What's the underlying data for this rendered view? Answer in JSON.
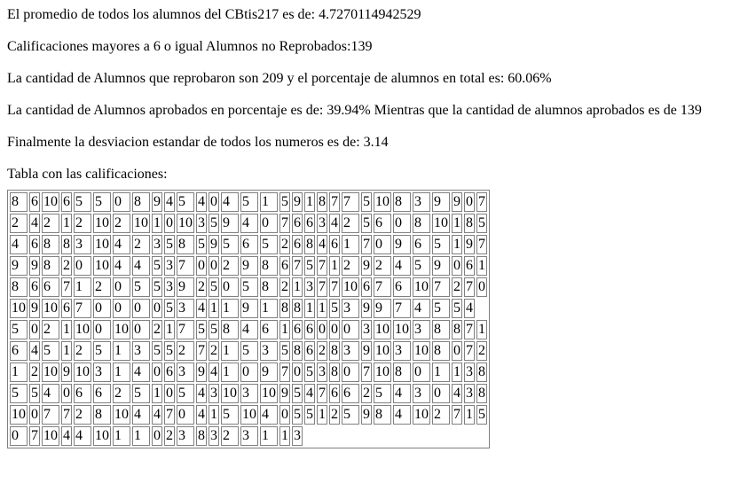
{
  "lines": {
    "promedio": "El promedio de todos los alumnos del CBtis217 es de: 4.7270114942529",
    "no_reprobados": "Calificaciones mayores a 6 o igual Alumnos no Reprobados:139",
    "reprobados": "La cantidad de Alumnos que reprobaron son 209 y el porcentaje de alumnos en total es: 60.06%",
    "aprobados": "La cantidad de Alumnos aprobados en porcentaje es de: 39.94% Mientras que la cantidad de alumnos aprobados es de 139",
    "desviacion": "Finalmente la desviacion estandar de todos los numeros es de: 3.14",
    "tabla_titulo": "Tabla con las calificaciones:"
  },
  "table": {
    "rows": [
      [
        "8",
        "6",
        "10",
        "6",
        "5",
        "5",
        "0",
        "8",
        "9",
        "4",
        "5",
        "4",
        "0",
        "4",
        "5",
        "1",
        "5",
        "9",
        "1",
        "8",
        "7",
        "7",
        "5",
        "10",
        "8",
        "3",
        "9",
        "9",
        "0",
        "7"
      ],
      [
        "2",
        "4",
        "2",
        "1",
        "2",
        "10",
        "2",
        "10",
        "1",
        "0",
        "10",
        "3",
        "5",
        "9",
        "4",
        "0",
        "7",
        "6",
        "6",
        "3",
        "4",
        "2",
        "5",
        "6",
        "0",
        "8",
        "10",
        "1",
        "8",
        "5"
      ],
      [
        "4",
        "6",
        "8",
        "8",
        "3",
        "10",
        "4",
        "2",
        "3",
        "5",
        "8",
        "5",
        "9",
        "5",
        "6",
        "5",
        "2",
        "6",
        "8",
        "4",
        "6",
        "1",
        "7",
        "0",
        "9",
        "6",
        "5",
        "1",
        "9",
        "7"
      ],
      [
        "9",
        "9",
        "8",
        "2",
        "0",
        "10",
        "4",
        "4",
        "5",
        "3",
        "7",
        "0",
        "0",
        "2",
        "9",
        "8",
        "6",
        "7",
        "5",
        "7",
        "1",
        "2",
        "9",
        "2",
        "4",
        "5",
        "9",
        "0",
        "6",
        "1"
      ],
      [
        "8",
        "6",
        "6",
        "7",
        "1",
        "2",
        "0",
        "5",
        "5",
        "3",
        "9",
        "2",
        "5",
        "0",
        "5",
        "8",
        "2",
        "1",
        "3",
        "7",
        "7",
        "10",
        "6",
        "7",
        "6",
        "10",
        "7",
        "2",
        "7",
        "0"
      ],
      [
        "10",
        "9",
        "10",
        "6",
        "7",
        "0",
        "0",
        "0",
        "0",
        "5",
        "3",
        "4",
        "1",
        "1",
        "9",
        "1",
        "8",
        "8",
        "1",
        "1",
        "5",
        "3",
        "9",
        "9",
        "7",
        "4",
        "5",
        "5",
        "4"
      ],
      [
        "5",
        "0",
        "2",
        "1",
        "10",
        "0",
        "10",
        "0",
        "2",
        "1",
        "7",
        "5",
        "5",
        "8",
        "4",
        "6",
        "1",
        "6",
        "6",
        "0",
        "0",
        "0",
        "3",
        "10",
        "10",
        "3",
        "8",
        "8",
        "7",
        "1"
      ],
      [
        "6",
        "4",
        "5",
        "1",
        "2",
        "5",
        "1",
        "3",
        "5",
        "5",
        "2",
        "7",
        "2",
        "1",
        "5",
        "3",
        "5",
        "8",
        "6",
        "2",
        "8",
        "3",
        "9",
        "10",
        "3",
        "10",
        "8",
        "0",
        "7",
        "2"
      ],
      [
        "1",
        "2",
        "10",
        "9",
        "10",
        "3",
        "1",
        "4",
        "0",
        "6",
        "3",
        "9",
        "4",
        "1",
        "0",
        "9",
        "7",
        "0",
        "5",
        "3",
        "8",
        "0",
        "7",
        "10",
        "8",
        "0",
        "1",
        "1",
        "3",
        "8"
      ],
      [
        "5",
        "5",
        "4",
        "0",
        "6",
        "6",
        "2",
        "5",
        "1",
        "0",
        "5",
        "4",
        "3",
        "10",
        "3",
        "10",
        "9",
        "5",
        "4",
        "7",
        "6",
        "6",
        "2",
        "5",
        "4",
        "3",
        "0",
        "4",
        "3",
        "8"
      ],
      [
        "10",
        "0",
        "7",
        "7",
        "2",
        "8",
        "10",
        "4",
        "4",
        "7",
        "0",
        "4",
        "1",
        "5",
        "10",
        "4",
        "0",
        "5",
        "5",
        "1",
        "2",
        "5",
        "9",
        "8",
        "4",
        "10",
        "2",
        "7",
        "1",
        "5"
      ],
      [
        "0",
        "7",
        "10",
        "4",
        "4",
        "10",
        "1",
        "1",
        "0",
        "2",
        "3",
        "8",
        "3",
        "2",
        "3",
        "1",
        "1",
        "3"
      ]
    ]
  }
}
